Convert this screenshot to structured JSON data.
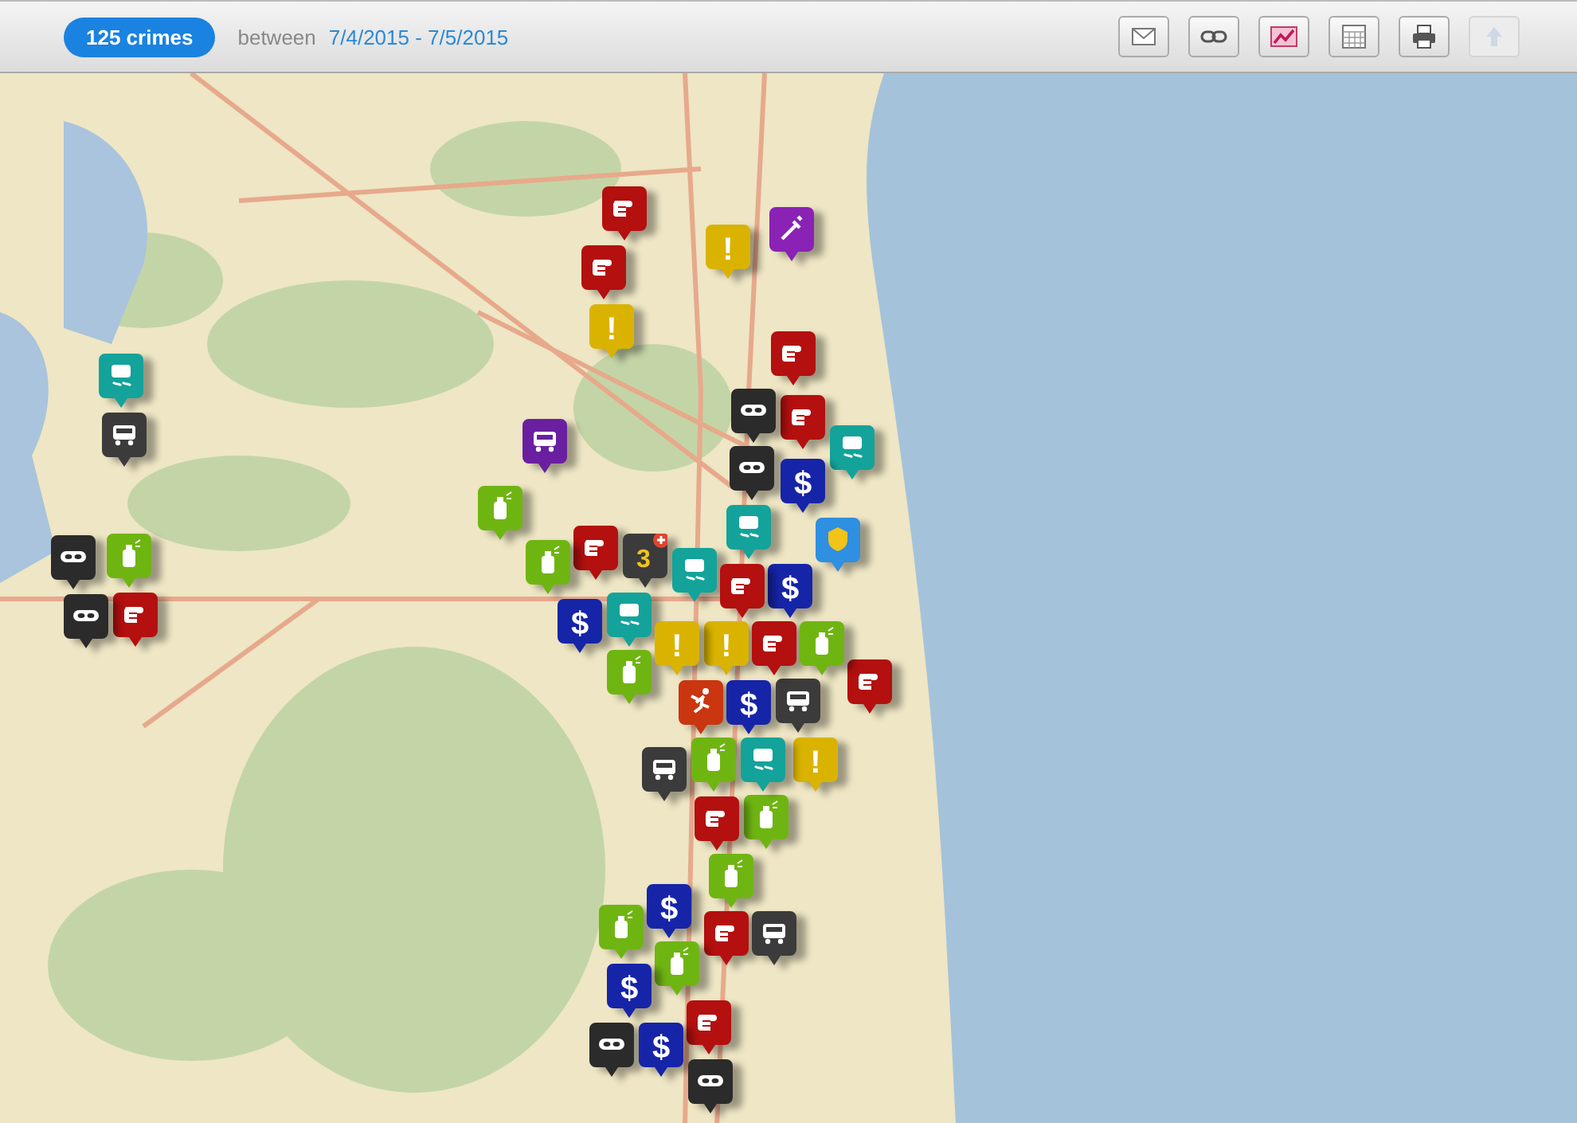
{
  "header": {
    "count_badge": "125 crimes",
    "range_label": "between",
    "date_range": "7/4/2015 - 7/5/2015",
    "buttons": [
      {
        "kind": "email",
        "disabled": false
      },
      {
        "kind": "link",
        "disabled": false
      },
      {
        "kind": "chart",
        "disabled": false
      },
      {
        "kind": "calendar",
        "disabled": false
      },
      {
        "kind": "print",
        "disabled": false
      },
      {
        "kind": "up",
        "disabled": true
      }
    ]
  },
  "map": {
    "markers": [
      {
        "kind": "fist",
        "color": "#b3100f"
      },
      {
        "kind": "fist",
        "color": "#b3100f"
      },
      {
        "kind": "symbol",
        "symbol": "!",
        "color": "#d9b300"
      },
      {
        "kind": "syringe",
        "color": "#8a22b5"
      },
      {
        "kind": "symbol",
        "symbol": "!",
        "color": "#d9b300"
      },
      {
        "kind": "fist",
        "color": "#b3100f"
      },
      {
        "kind": "skid",
        "color": "#13a39a"
      },
      {
        "kind": "car",
        "color": "#3b3b3b"
      },
      {
        "kind": "fist",
        "color": "#b3100f"
      },
      {
        "kind": "mask",
        "color": "#2b2b2b"
      },
      {
        "kind": "skid",
        "color": "#13a39a"
      },
      {
        "kind": "car",
        "color": "#6a1fa0"
      },
      {
        "kind": "mask",
        "color": "#2b2b2b"
      },
      {
        "kind": "symbol",
        "symbol": "$",
        "color": "#1624a8"
      },
      {
        "kind": "spray",
        "color": "#6fb512"
      },
      {
        "kind": "badge",
        "color": "#2f8fe0"
      },
      {
        "kind": "fist",
        "color": "#b3100f"
      },
      {
        "kind": "cluster",
        "count": "3",
        "color": "#3b3b3b"
      },
      {
        "kind": "spray",
        "color": "#6fb512"
      },
      {
        "kind": "skid",
        "color": "#13a39a"
      },
      {
        "kind": "symbol",
        "symbol": "$",
        "color": "#1624a8"
      },
      {
        "kind": "symbol",
        "symbol": "$",
        "color": "#1624a8"
      },
      {
        "kind": "skid",
        "color": "#13a39a"
      },
      {
        "kind": "symbol",
        "symbol": "!",
        "color": "#d9b300"
      },
      {
        "kind": "spray",
        "color": "#6fb512"
      },
      {
        "kind": "symbol",
        "symbol": "!",
        "color": "#d9b300"
      },
      {
        "kind": "person",
        "color": "#c9360f"
      },
      {
        "kind": "symbol",
        "symbol": "$",
        "color": "#1624a8"
      },
      {
        "kind": "fist",
        "color": "#b3100f"
      },
      {
        "kind": "car",
        "color": "#3b3b3b"
      },
      {
        "kind": "symbol",
        "symbol": "!",
        "color": "#d9b300"
      },
      {
        "kind": "car",
        "color": "#3b3b3b"
      },
      {
        "kind": "spray",
        "color": "#6fb512"
      },
      {
        "kind": "spray",
        "color": "#6fb512"
      },
      {
        "kind": "fist",
        "color": "#b3100f"
      },
      {
        "kind": "spray",
        "color": "#6fb512"
      },
      {
        "kind": "fist",
        "color": "#b3100f"
      },
      {
        "kind": "car",
        "color": "#3b3b3b"
      },
      {
        "kind": "spray",
        "color": "#6fb512"
      },
      {
        "kind": "symbol",
        "symbol": "$",
        "color": "#1624a8"
      },
      {
        "kind": "spray",
        "color": "#6fb512"
      },
      {
        "kind": "symbol",
        "symbol": "$",
        "color": "#1624a8"
      },
      {
        "kind": "fist",
        "color": "#b3100f"
      },
      {
        "kind": "mask",
        "color": "#2b2b2b"
      },
      {
        "kind": "symbol",
        "symbol": "$",
        "color": "#1624a8"
      },
      {
        "kind": "mask",
        "color": "#2b2b2b"
      },
      {
        "kind": "mask",
        "color": "#2b2b2b"
      },
      {
        "kind": "spray",
        "color": "#6fb512"
      },
      {
        "kind": "fist",
        "color": "#b3100f"
      },
      {
        "kind": "mask",
        "color": "#2b2b2b"
      },
      {
        "kind": "skid",
        "color": "#13a39a"
      },
      {
        "kind": "fist",
        "color": "#b3100f"
      },
      {
        "kind": "fist",
        "color": "#b3100f"
      },
      {
        "kind": "spray",
        "color": "#6fb512"
      },
      {
        "kind": "skid",
        "color": "#13a39a"
      }
    ]
  }
}
